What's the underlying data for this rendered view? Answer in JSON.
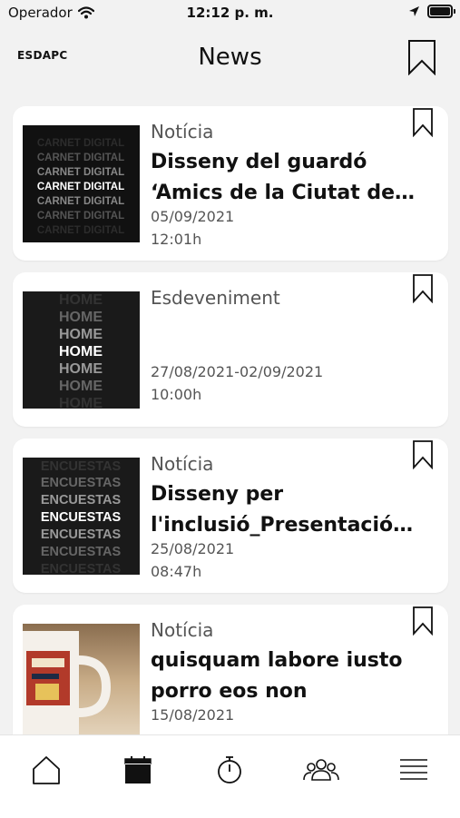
{
  "status_bar": {
    "carrier": "Operador",
    "time": "12:12 p. m."
  },
  "header": {
    "brand": "ESDAPC",
    "title": "News"
  },
  "cards": [
    {
      "type": "Notícia",
      "title_line1": "Disseny del guardó",
      "title_line2": "‘Amics de la Ciutat de…",
      "date": "05/09/2021",
      "time": "12:01h",
      "thumb_text": "CARNET DIGITAL"
    },
    {
      "type": "Esdeveniment",
      "title_line1": "",
      "title_line2": "",
      "date": "27/08/2021-02/09/2021",
      "time": "10:00h",
      "thumb_text": "HOME"
    },
    {
      "type": "Notícia",
      "title_line1": "Disseny per",
      "title_line2": "l'inclusió_Presentació…",
      "date": "25/08/2021",
      "time": "08:47h",
      "thumb_text": "ENCUESTAS"
    },
    {
      "type": "Notícia",
      "title_line1": "quisquam labore iusto",
      "title_line2": "porro eos non",
      "date": "15/08/2021",
      "time": "",
      "thumb_text": ""
    }
  ],
  "tabs": [
    {
      "icon": "home-icon"
    },
    {
      "icon": "calendar-icon",
      "active": true
    },
    {
      "icon": "stopwatch-icon"
    },
    {
      "icon": "people-icon"
    },
    {
      "icon": "menu-icon"
    }
  ],
  "colors": {
    "background": "#f2f2f2",
    "card": "#ffffff",
    "text": "#111111",
    "muted": "#555555"
  }
}
